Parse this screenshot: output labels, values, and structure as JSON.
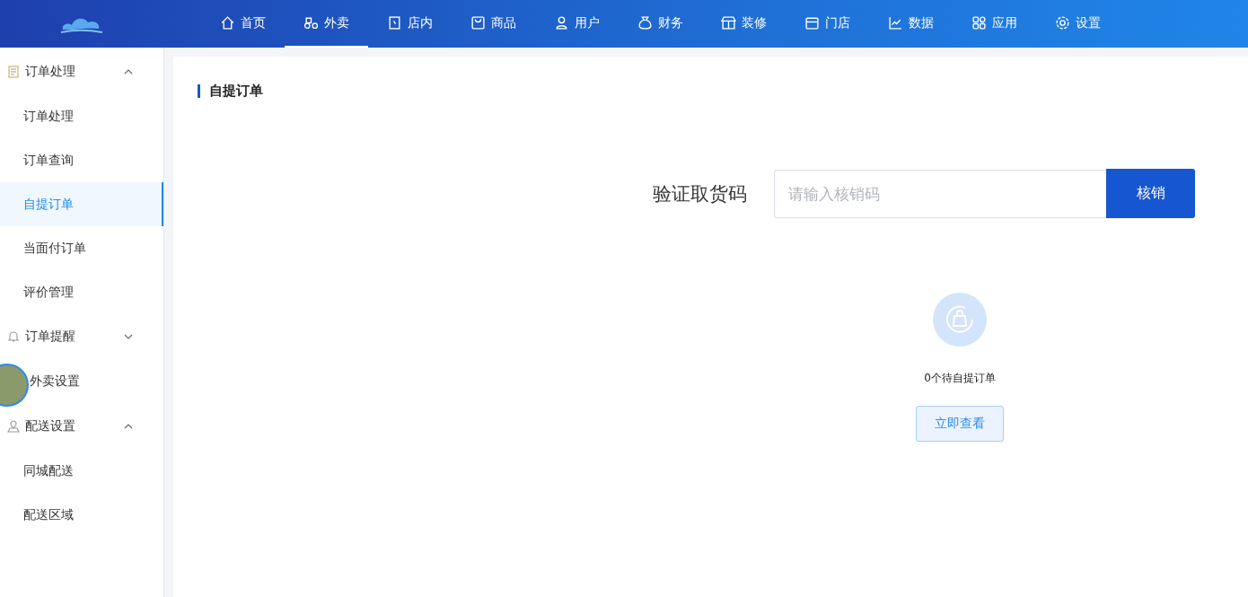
{
  "nav": [
    {
      "label": "首页",
      "selected": false
    },
    {
      "label": "外卖",
      "selected": true
    },
    {
      "label": "店内",
      "selected": false
    },
    {
      "label": "商品",
      "selected": false
    },
    {
      "label": "用户",
      "selected": false
    },
    {
      "label": "财务",
      "selected": false
    },
    {
      "label": "装修",
      "selected": false
    },
    {
      "label": "门店",
      "selected": false
    },
    {
      "label": "数据",
      "selected": false
    },
    {
      "label": "应用",
      "selected": false
    },
    {
      "label": "设置",
      "selected": false
    }
  ],
  "sidebar": {
    "groups": [
      {
        "label": "订单处理",
        "expanded": true,
        "children": [
          {
            "label": "订单处理",
            "selected": false
          },
          {
            "label": "订单查询",
            "selected": false
          },
          {
            "label": "自提订单",
            "selected": true
          },
          {
            "label": "当面付订单",
            "selected": false
          },
          {
            "label": "评价管理",
            "selected": false
          }
        ]
      },
      {
        "label": "订单提醒",
        "expanded": false
      },
      {
        "label": "外卖设置"
      },
      {
        "label": "配送设置",
        "expanded": true,
        "children": [
          {
            "label": "同城配送",
            "selected": false
          },
          {
            "label": "配送区域",
            "selected": false
          }
        ]
      }
    ]
  },
  "page": {
    "title": "自提订单",
    "verify_label": "验证取货码",
    "code_field": {
      "placeholder": "请输入核销码"
    },
    "verify_button": "核销",
    "pending_text": "0个待自提订单",
    "view_button": "立即查看"
  }
}
